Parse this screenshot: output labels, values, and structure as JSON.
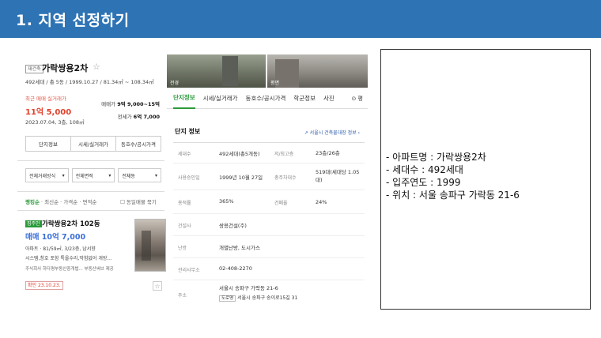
{
  "slide": {
    "title": "1. 지역 선정하기"
  },
  "listing_panel": {
    "badge": "재건축",
    "apt_name": "가락쌍용2차",
    "apt_info": "492세대 / 총 5동 / 1999.10.27 / 81.34㎡ ~ 108.34㎡",
    "recent_label": "최근 매매 실거래가",
    "recent_price": "11억 5,000",
    "recent_date": "2023.07.04, 3층, 108㎡",
    "sale_range_label": "매매가",
    "sale_range_value": "9억 9,000~15억",
    "jeonse_label": "전세가",
    "jeonse_value": "6억 7,000",
    "buttons": [
      "단지정보",
      "시세/실거래가",
      "동호수/공시가격"
    ],
    "filters": [
      "전체거래방식",
      "전체면적",
      "전체동"
    ],
    "sort": {
      "active": "랭킹순",
      "items": [
        "최신순",
        "가격순",
        "면적순"
      ],
      "check": "동일매물 묶기"
    },
    "item": {
      "badge": "집주인",
      "name": "가락쌍용2차 102동",
      "price": "매매 10억 7,000",
      "desc1": "아파트 · 81/59㎡, 3/23층, 남서향",
      "desc2": "시스템,창호 포함 특올수리,막힘없어 개방...",
      "desc3": "주식회사 하다평부동산중개법...  부동산써브 제공",
      "confirm": "확인 23.10.23.",
      "fav_icon": "☆"
    }
  },
  "detail_panel": {
    "photo_captions": [
      "전경",
      "평면"
    ],
    "tabs": [
      "단지정보",
      "시세/실거래가",
      "동호수/공시가격",
      "학군정보",
      "사진"
    ],
    "tab_extra": "⊙ 평",
    "section_title": "단지 정보",
    "section_link": "서울시 건축물대장 정보 ›",
    "rows": [
      {
        "k": "세대수",
        "v": "492세대(총5개동)",
        "k2": "저/최고층",
        "v2": "23층/26층"
      },
      {
        "k": "사용승인일",
        "v": "1999년 10월 27일",
        "k2": "총주차대수",
        "v2": "519대(세대당 1.05대)"
      },
      {
        "k": "용적률",
        "v": "365%",
        "k2": "건폐율",
        "v2": "24%"
      },
      {
        "k": "건설사",
        "v": "쌍용건설(주)",
        "k2": "",
        "v2": ""
      },
      {
        "k": "난방",
        "v": "개별난방, 도시가스",
        "k2": "",
        "v2": ""
      },
      {
        "k": "관리사무소",
        "v": "02-408-2270",
        "k2": "",
        "v2": ""
      },
      {
        "k": "주소",
        "v": "서울시 송파구 가락동 21-6",
        "k2": "",
        "v2": ""
      }
    ],
    "road_label": "도로명",
    "road_address": "서울시 송파구 송이로15길 31"
  },
  "info_box": {
    "lines": [
      "아파트명 : 가락쌍용2차",
      "세대수 : 492세대",
      "입주연도 : 1999",
      "위치 : 서울 송파구 가락동 21-6"
    ]
  }
}
